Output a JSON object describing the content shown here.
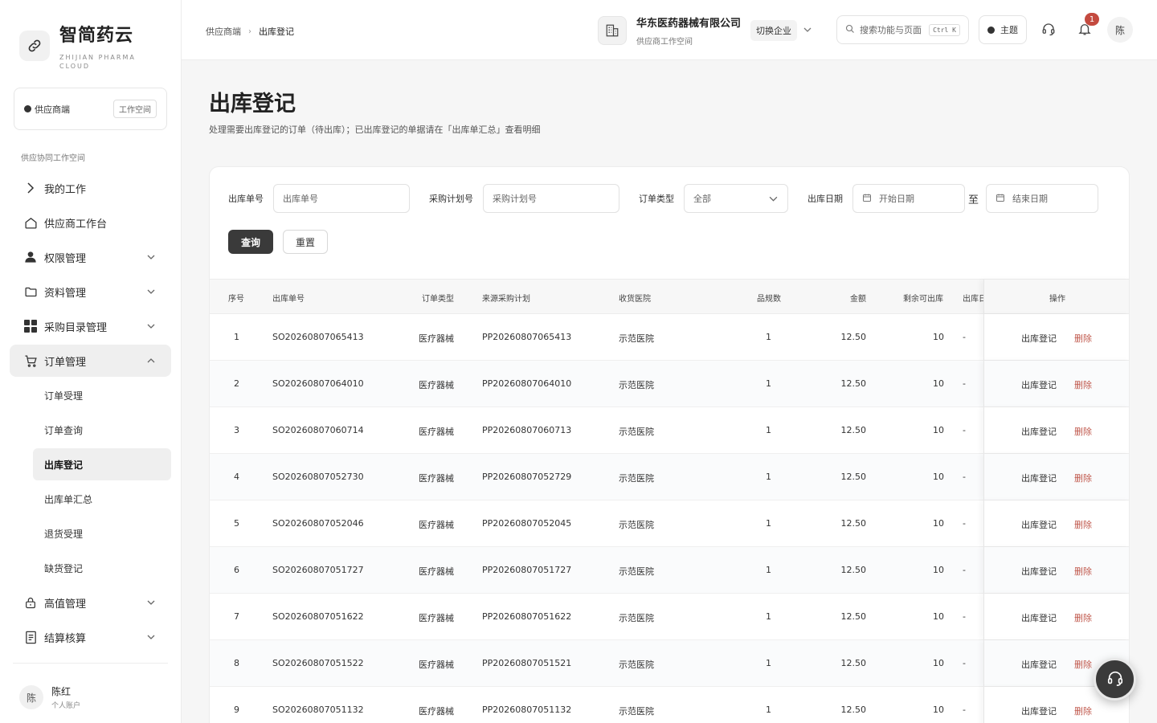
{
  "app": {
    "title": "智简药云",
    "subtitle": "ZHIJIAN PHARMA CLOUD"
  },
  "workspace": {
    "label": "供应商端",
    "badge": "工作空间"
  },
  "sidebar": {
    "section_label": "供应协同工作空间",
    "items": [
      {
        "label": "我的工作",
        "icon": "chevron-right-icon"
      },
      {
        "label": "供应商工作台",
        "icon": "home-icon"
      },
      {
        "label": "权限管理",
        "icon": "user-icon"
      },
      {
        "label": "资料管理",
        "icon": "folder-icon"
      },
      {
        "label": "采购目录管理",
        "icon": "grid-icon"
      },
      {
        "label": "订单管理",
        "icon": "cart-icon"
      },
      {
        "label": "高值管理",
        "icon": "lock-icon"
      },
      {
        "label": "结算核算",
        "icon": "document-icon"
      }
    ],
    "submenu": [
      {
        "label": "订单受理"
      },
      {
        "label": "订单查询"
      },
      {
        "label": "出库登记"
      },
      {
        "label": "出库单汇总"
      },
      {
        "label": "退货受理"
      },
      {
        "label": "缺货登记"
      }
    ]
  },
  "user": {
    "avatar": "陈",
    "name": "陈红",
    "role": "个人账户"
  },
  "topbar": {
    "breadcrumb_root": "供应商端",
    "breadcrumb_sep": "›",
    "breadcrumb_current": "出库登记",
    "company_name": "华东医药器械有限公司",
    "company_sub": "供应商工作空间",
    "switch_label": "切换企业",
    "search_placeholder": "搜索功能与页面",
    "search_shortcut": "Ctrl K",
    "theme_label": "主题",
    "notification_count": "1",
    "avatar": "陈"
  },
  "page": {
    "title": "出库登记",
    "description": "处理需要出库登记的订单（待出库）；已出库登记的单据请在「出库单汇总」查看明细"
  },
  "filters": {
    "order_no_label": "出库单号",
    "order_no_placeholder": "出库单号",
    "plan_no_label": "采购计划号",
    "plan_no_placeholder": "采购计划号",
    "order_type_label": "订单类型",
    "order_type_value": "全部",
    "date_label": "出库日期",
    "start_placeholder": "开始日期",
    "range_sep": "至",
    "end_placeholder": "结束日期",
    "query_button": "查询",
    "reset_button": "重置"
  },
  "table": {
    "headers": {
      "index": "序号",
      "order_no": "出库单号",
      "order_type": "订单类型",
      "source_plan": "来源采购计划",
      "hospital": "收货医院",
      "spec_count": "品规数",
      "amount": "金额",
      "remaining": "剩余可出库",
      "out_date": "出库日",
      "ops": "操作"
    },
    "op_out_label": "出库登记",
    "op_delete_label": "删除",
    "rows": [
      {
        "index": "1",
        "order_no": "SO20260807065413",
        "order_type": "医疗器械",
        "source_plan": "PP20260807065413",
        "hospital": "示范医院",
        "spec_count": "1",
        "amount": "12.50",
        "remaining": "10",
        "out_date": "-"
      },
      {
        "index": "2",
        "order_no": "SO20260807064010",
        "order_type": "医疗器械",
        "source_plan": "PP20260807064010",
        "hospital": "示范医院",
        "spec_count": "1",
        "amount": "12.50",
        "remaining": "10",
        "out_date": "-"
      },
      {
        "index": "3",
        "order_no": "SO20260807060714",
        "order_type": "医疗器械",
        "source_plan": "PP20260807060713",
        "hospital": "示范医院",
        "spec_count": "1",
        "amount": "12.50",
        "remaining": "10",
        "out_date": "-"
      },
      {
        "index": "4",
        "order_no": "SO20260807052730",
        "order_type": "医疗器械",
        "source_plan": "PP20260807052729",
        "hospital": "示范医院",
        "spec_count": "1",
        "amount": "12.50",
        "remaining": "10",
        "out_date": "-"
      },
      {
        "index": "5",
        "order_no": "SO20260807052046",
        "order_type": "医疗器械",
        "source_plan": "PP20260807052045",
        "hospital": "示范医院",
        "spec_count": "1",
        "amount": "12.50",
        "remaining": "10",
        "out_date": "-"
      },
      {
        "index": "6",
        "order_no": "SO20260807051727",
        "order_type": "医疗器械",
        "source_plan": "PP20260807051727",
        "hospital": "示范医院",
        "spec_count": "1",
        "amount": "12.50",
        "remaining": "10",
        "out_date": "-"
      },
      {
        "index": "7",
        "order_no": "SO20260807051622",
        "order_type": "医疗器械",
        "source_plan": "PP20260807051622",
        "hospital": "示范医院",
        "spec_count": "1",
        "amount": "12.50",
        "remaining": "10",
        "out_date": "-"
      },
      {
        "index": "8",
        "order_no": "SO20260807051522",
        "order_type": "医疗器械",
        "source_plan": "PP20260807051521",
        "hospital": "示范医院",
        "spec_count": "1",
        "amount": "12.50",
        "remaining": "10",
        "out_date": "-"
      },
      {
        "index": "9",
        "order_no": "SO20260807051132",
        "order_type": "医疗器械",
        "source_plan": "PP20260807051132",
        "hospital": "示范医院",
        "spec_count": "1",
        "amount": "12.50",
        "remaining": "10",
        "out_date": "-"
      }
    ]
  },
  "colors": {
    "primary": "#3a3a3a",
    "danger": "#c0584c",
    "badge": "#c44a3f"
  },
  "fab_icon": "headset-icon"
}
